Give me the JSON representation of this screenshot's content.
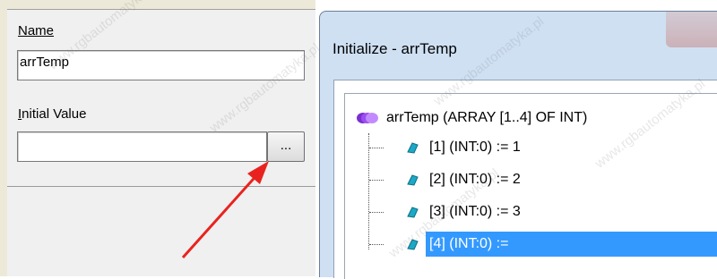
{
  "properties": {
    "name_label": "Name",
    "name_value": "arrTemp",
    "initial_value_label": "Initial Value",
    "initial_value_value": "",
    "browse_button_label": "..."
  },
  "dialog": {
    "title": "Initialize - arrTemp",
    "tree": {
      "root": "arrTemp (ARRAY [1..4] OF INT)",
      "items": [
        "[1] (INT:0) := 1",
        "[2] (INT:0) := 2",
        "[3] (INT:0) := 3",
        "[4] (INT:0) :="
      ],
      "selected_index": 3
    }
  },
  "watermark": "www.rgbautomatyka.pl",
  "colors": {
    "selection": "#3399ff",
    "arrow": "#e8231f",
    "dialog_frame": "#cfe0f3"
  }
}
